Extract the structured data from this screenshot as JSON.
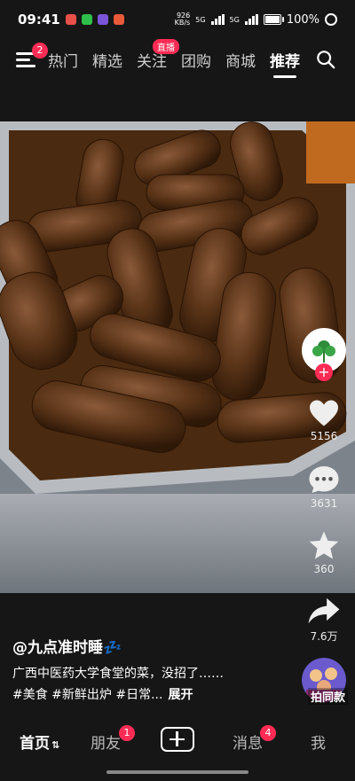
{
  "status": {
    "time": "09:41",
    "net_speed": "926",
    "net_unit": "KB/s",
    "signal1": "5G",
    "signal2": "5G",
    "battery": "100%"
  },
  "nav": {
    "menu_badge": "2",
    "tabs": [
      "热门",
      "精选",
      "关注",
      "团购",
      "商城",
      "推荐"
    ],
    "live_tag": "直播"
  },
  "actions": {
    "likes": "5156",
    "comments": "3631",
    "favorites": "360",
    "shares": "7.6万"
  },
  "post": {
    "author": "@九点准时睡💤",
    "caption": "广西中医药大学食堂的菜，没招了……",
    "hashtags": "#美食 #新鲜出炉 #日常...",
    "expand": "展开",
    "music_label": "拍同款"
  },
  "bottom_nav": {
    "home": "首页",
    "friends": "朋友",
    "friends_badge": "1",
    "messages": "消息",
    "messages_badge": "4",
    "me": "我"
  },
  "colors": {
    "accent": "#fe2c55",
    "background": "#161616"
  }
}
